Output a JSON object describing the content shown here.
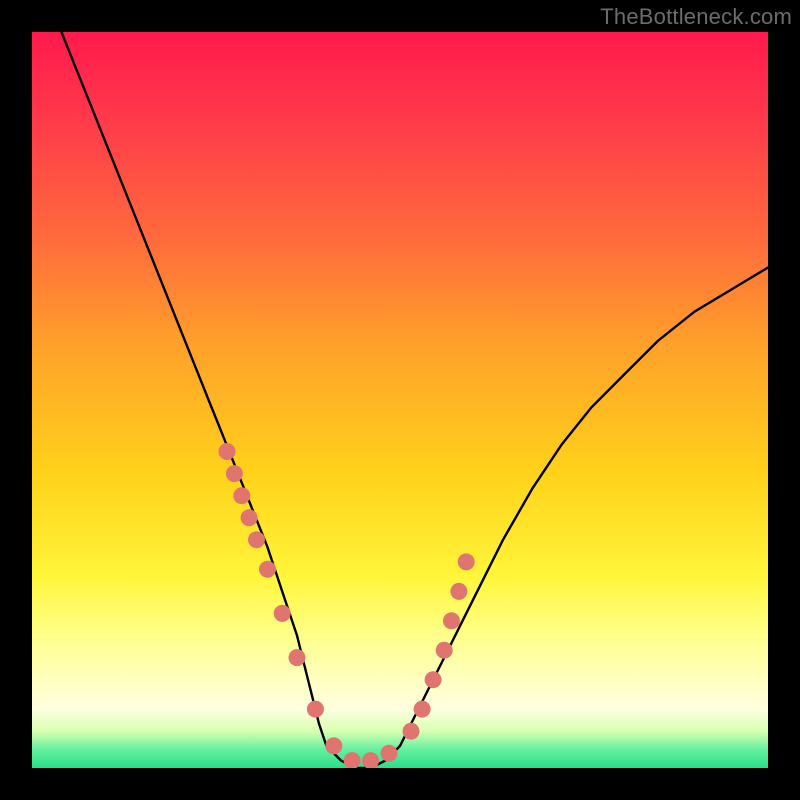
{
  "watermark": "TheBottleneck.com",
  "colors": {
    "background": "#000000",
    "curve": "#000000",
    "marker_fill": "#e0746f",
    "marker_stroke": "#c85a55",
    "gradient_top": "#ff1a4d",
    "gradient_bottom": "#28e089"
  },
  "chart_data": {
    "type": "line",
    "title": "",
    "xlabel": "",
    "ylabel": "",
    "xlim": [
      0,
      100
    ],
    "ylim": [
      0,
      100
    ],
    "grid": false,
    "legend": false,
    "series": [
      {
        "name": "bottleneck-curve",
        "x": [
          0,
          4,
          8,
          12,
          16,
          20,
          24,
          26,
          28,
          30,
          32,
          34,
          36,
          37,
          38,
          39,
          40,
          42,
          44,
          46,
          48,
          50,
          52,
          56,
          60,
          64,
          68,
          72,
          76,
          80,
          85,
          90,
          95,
          100
        ],
        "y": [
          110,
          100,
          90,
          80,
          70,
          60,
          50,
          45,
          40,
          35,
          30,
          24,
          18,
          14,
          10,
          6,
          3,
          1,
          0,
          0,
          1,
          3,
          7,
          15,
          23,
          31,
          38,
          44,
          49,
          53,
          58,
          62,
          65,
          68
        ]
      }
    ],
    "markers": {
      "name": "highlight-points",
      "x": [
        26.5,
        27.5,
        28.5,
        29.5,
        30.5,
        32.0,
        34.0,
        36.0,
        38.5,
        41.0,
        43.5,
        46.0,
        48.5,
        51.5,
        53.0,
        54.5,
        56.0,
        57.0,
        58.0,
        59.0
      ],
      "y": [
        43,
        40,
        37,
        34,
        31,
        27,
        21,
        15,
        8,
        3,
        1,
        1,
        2,
        5,
        8,
        12,
        16,
        20,
        24,
        28
      ]
    }
  }
}
